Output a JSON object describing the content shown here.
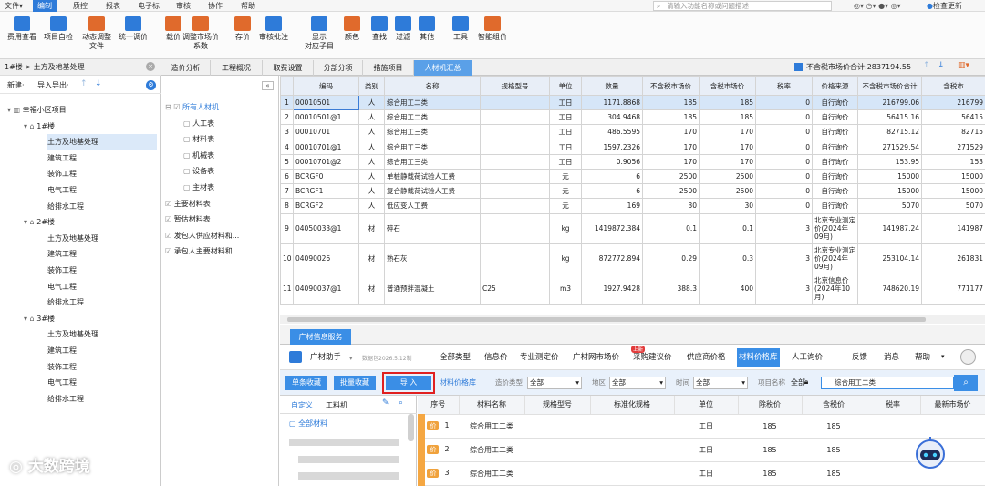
{
  "menubar": {
    "items": [
      "文件▾",
      "编制",
      "质控",
      "报表",
      "电子标",
      "审核",
      "协作",
      "帮助"
    ],
    "search_placeholder": "请输入功能名称或问题描述",
    "update": "检查更新"
  },
  "toolbar": {
    "items": [
      "费用查看",
      "项目自检",
      "动态调整\n文件",
      "统一调价",
      "载价",
      "调整市场价\n系数",
      "存价",
      "审核批注",
      "显示\n对应子目",
      "颜色",
      "查找",
      "过滤",
      "其他",
      "工具",
      "智能组价"
    ]
  },
  "project": {
    "breadcrumb": "1#楼 > 土方及地基处理",
    "new_label": "新建·",
    "import_label": "导入导出·",
    "root": "幸福小区项目",
    "buildings": [
      {
        "name": "1#楼",
        "items": [
          "土方及地基处理",
          "建筑工程",
          "装饰工程",
          "电气工程",
          "给排水工程"
        ]
      },
      {
        "name": "2#楼",
        "items": [
          "土方及地基处理",
          "建筑工程",
          "装饰工程",
          "电气工程",
          "给排水工程"
        ]
      },
      {
        "name": "3#楼",
        "items": [
          "土方及地基处理",
          "建筑工程",
          "装饰工程",
          "电气工程",
          "给排水工程"
        ]
      }
    ]
  },
  "tabs": [
    "造价分析",
    "工程概况",
    "取费设置",
    "分部分项",
    "措施项目",
    "人材机汇总"
  ],
  "total_label": "不含税市场价合计:2837194.55",
  "material_tree": {
    "root": "所有人材机",
    "children": [
      "人工表",
      "材料表",
      "机械表",
      "设备表",
      "主材表"
    ],
    "others": [
      "主要材料表",
      "暂估材料表",
      "发包人供应材料和...",
      "承包人主要材料和..."
    ]
  },
  "grid": {
    "headers": [
      "编码",
      "类别",
      "名称",
      "规格型号",
      "单位",
      "数量",
      "不含税市场价",
      "含税市场价",
      "税率",
      "价格来源",
      "不含税市场价合计",
      "含税市"
    ],
    "rows": [
      [
        "1",
        "00010501",
        "人",
        "综合用工二类",
        "",
        "工日",
        "1171.8868",
        "185",
        "185",
        "0",
        "自行询价",
        "216799.06",
        "216799"
      ],
      [
        "2",
        "00010501@1",
        "人",
        "综合用工二类",
        "",
        "工日",
        "304.9468",
        "185",
        "185",
        "0",
        "自行询价",
        "56415.16",
        "56415"
      ],
      [
        "3",
        "00010701",
        "人",
        "综合用工三类",
        "",
        "工日",
        "486.5595",
        "170",
        "170",
        "0",
        "自行询价",
        "82715.12",
        "82715"
      ],
      [
        "4",
        "00010701@1",
        "人",
        "综合用工三类",
        "",
        "工日",
        "1597.2326",
        "170",
        "170",
        "0",
        "自行询价",
        "271529.54",
        "271529"
      ],
      [
        "5",
        "00010701@2",
        "人",
        "综合用工三类",
        "",
        "工日",
        "0.9056",
        "170",
        "170",
        "0",
        "自行询价",
        "153.95",
        "153"
      ],
      [
        "6",
        "BCRGF0",
        "人",
        "单桩静载荷试验人工费",
        "",
        "元",
        "6",
        "2500",
        "2500",
        "0",
        "自行询价",
        "15000",
        "15000"
      ],
      [
        "7",
        "BCRGF1",
        "人",
        "复合静载荷试验人工费",
        "",
        "元",
        "6",
        "2500",
        "2500",
        "0",
        "自行询价",
        "15000",
        "15000"
      ],
      [
        "8",
        "BCRGF2",
        "人",
        "低应变人工费",
        "",
        "元",
        "169",
        "30",
        "30",
        "0",
        "自行询价",
        "5070",
        "5070"
      ],
      [
        "9",
        "04050033@1",
        "材",
        "碎石",
        "",
        "kg",
        "1419872.384",
        "0.1",
        "0.1",
        "3",
        "北京专业测定价(2024年09月)",
        "141987.24",
        "141987"
      ],
      [
        "10",
        "04090026",
        "材",
        "熟石灰",
        "",
        "kg",
        "872772.894",
        "0.29",
        "0.3",
        "3",
        "北京专业测定价(2024年09月)",
        "253104.14",
        "261831"
      ],
      [
        "11",
        "04090037@1",
        "材",
        "普通预拌混凝土",
        "C25",
        "m3",
        "1927.9428",
        "388.3",
        "400",
        "3",
        "北京信息价(2024年10月)",
        "748620.19",
        "771177"
      ]
    ]
  },
  "info": {
    "tab": "广材信息服务",
    "logo": "广材助手",
    "version": "数据包2026.5.12制",
    "nav": [
      "全部类型",
      "信息价",
      "专业测定价",
      "广材网市场价",
      "采购建议价",
      "供应商价格",
      "材料价格库",
      "人工询价",
      "反馈",
      "消息",
      "帮助"
    ],
    "badge": "上新"
  },
  "actions": {
    "single": "单条收藏",
    "batch": "批量收藏",
    "import": "导 入",
    "lib": "材料价格库",
    "price_type_label": "造价类型",
    "price_type": "全部",
    "region_label": "地区",
    "region": "全部",
    "time_label": "时间",
    "time": "全部",
    "name_label": "项目名称",
    "name_val": "全部",
    "search": "综合用工二类"
  },
  "category": {
    "tab1": "自定义",
    "tab2": "工料机",
    "all": "全部材料"
  },
  "lower": {
    "headers": [
      "序号",
      "材料名称",
      "规格型号",
      "标准化规格",
      "单位",
      "除税价",
      "含税价",
      "税率",
      "最新市场价"
    ],
    "rows": [
      [
        "1",
        "综合用工二类",
        "",
        "",
        "工日",
        "185",
        "185",
        "",
        ""
      ],
      [
        "2",
        "综合用工二类",
        "",
        "",
        "工日",
        "185",
        "185",
        "",
        ""
      ],
      [
        "3",
        "综合用工二类",
        "",
        "",
        "工日",
        "185",
        "185",
        "",
        ""
      ]
    ]
  },
  "watermark": "大数跨境"
}
